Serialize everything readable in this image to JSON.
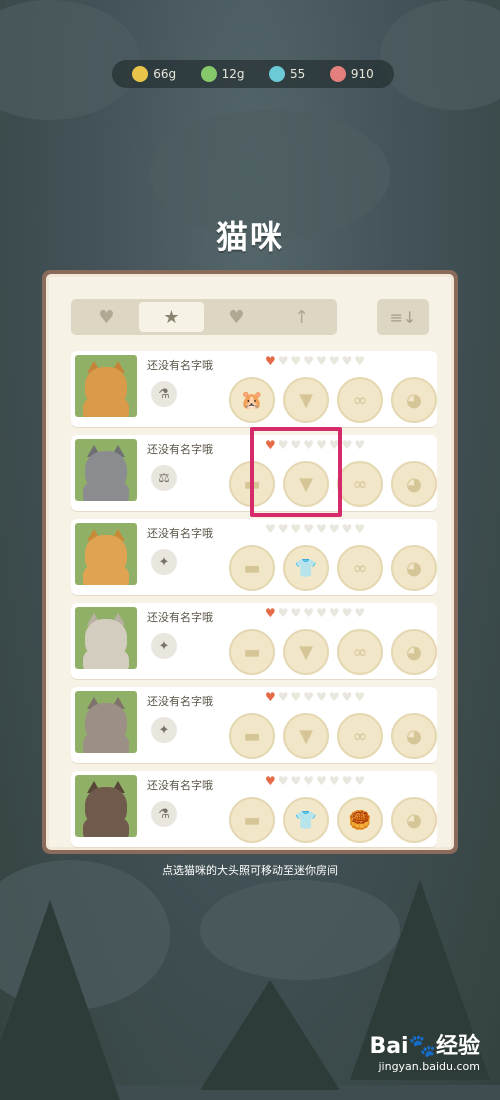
{
  "resources": [
    {
      "icon": "coin-icon",
      "value": "66g",
      "color": "#e8c54a"
    },
    {
      "icon": "leaf-icon",
      "value": "12g",
      "color": "#86c96a"
    },
    {
      "icon": "gem-icon",
      "value": "55",
      "color": "#6cc9d6"
    },
    {
      "icon": "fish-icon",
      "value": "910",
      "color": "#e37f7c"
    }
  ],
  "title": "猫咪",
  "filter_tabs": [
    {
      "icon": "cat-face-icon",
      "glyph": "♥"
    },
    {
      "icon": "star-icon",
      "glyph": "★"
    },
    {
      "icon": "heart-icon",
      "glyph": "♥"
    },
    {
      "icon": "arrow-up-icon",
      "glyph": "↑"
    }
  ],
  "sort_glyph": "≡↓",
  "cats": [
    {
      "name": "还没有名字哦",
      "hearts": 1,
      "item_glyph": "⚗",
      "fur": "#d99a4a",
      "ear": "#c68438",
      "slots": [
        "🐹",
        "",
        "",
        ""
      ]
    },
    {
      "name": "还没有名字哦",
      "hearts": 1,
      "item_glyph": "⚖",
      "fur": "#8b8c90",
      "ear": "#6f7074",
      "slots": [
        "",
        "",
        "",
        ""
      ]
    },
    {
      "name": "还没有名字哦",
      "hearts": 0,
      "item_glyph": "✦",
      "fur": "#e0a352",
      "ear": "#c98a38",
      "slots": [
        "",
        "👕",
        "",
        ""
      ]
    },
    {
      "name": "还没有名字哦",
      "hearts": 1,
      "item_glyph": "✦",
      "fur": "#d3cdc0",
      "ear": "#b8b1a3",
      "slots": [
        "",
        "",
        "",
        ""
      ]
    },
    {
      "name": "还没有名字哦",
      "hearts": 1,
      "item_glyph": "✦",
      "fur": "#9c8f86",
      "ear": "#7e726a",
      "slots": [
        "",
        "",
        "",
        ""
      ]
    },
    {
      "name": "还没有名字哦",
      "hearts": 1,
      "item_glyph": "⚗",
      "fur": "#6f5a4c",
      "ear": "#5a4639",
      "slots": [
        "",
        "👕",
        "🥮",
        ""
      ]
    }
  ],
  "hint": "点选猫咪的大头照可移动至迷你房间",
  "watermark": {
    "logo": "Bai🐾经验",
    "sub": "jingyan.baidu.com"
  }
}
